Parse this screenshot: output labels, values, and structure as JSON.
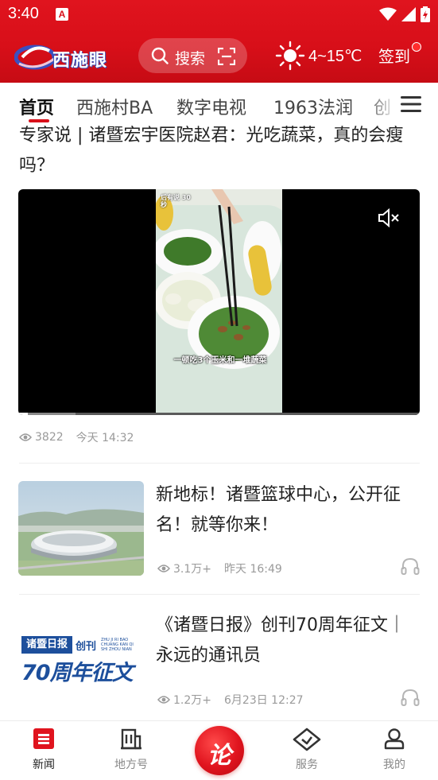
{
  "status_bar": {
    "time": "3:40",
    "notification_icon": "a-icon",
    "icons": [
      "wifi-icon",
      "signal-icon",
      "battery-icon"
    ]
  },
  "header": {
    "logo_text": "西施眼",
    "search_label": "搜索",
    "weather_icon": "sun-icon",
    "weather_temp": "4~15℃",
    "signin_label": "签到"
  },
  "tabs": [
    {
      "label": "首页",
      "active": true
    },
    {
      "label": "西施村BA",
      "active": false
    },
    {
      "label": "数字电视",
      "active": false
    },
    {
      "label": "1963法润",
      "active": false
    },
    {
      "label": "创",
      "active": false
    }
  ],
  "feed": {
    "featured": {
      "title": "专家说 | 诸暨宏宇医院赵君：光吃蔬菜，真的会瘦吗？",
      "video_caption": "一顿吃3个玉米和一堆蔬菜",
      "video_watermark": "后有说 30秒",
      "views": "3822",
      "time": "今天 14:32"
    },
    "items": [
      {
        "title": "新地标！诸暨篮球中心，公开征名！就等你来！",
        "views": "3.1万+",
        "time": "昨天 16:49"
      },
      {
        "title": "《诸暨日报》创刊70周年征文｜永远的通讯员",
        "views": "1.2万+",
        "time": "6月23日 12:27",
        "thumb_line1": "诸暨日报",
        "thumb_line1b": "创刊",
        "thumb_line2": "70周年征文",
        "thumb_small": "ZHU JI RI BAO CHUANG KAN QI SHI ZHOU NIAN ZHENG WEN"
      }
    ]
  },
  "bottom_nav": [
    {
      "label": "新闻",
      "icon": "news-icon",
      "active": true
    },
    {
      "label": "地方号",
      "icon": "building-icon",
      "active": false
    },
    {
      "label": "论",
      "icon": "center-logo",
      "active": false
    },
    {
      "label": "服务",
      "icon": "diamond-heart-icon",
      "active": false
    },
    {
      "label": "我的",
      "icon": "user-icon",
      "active": false
    }
  ],
  "colors": {
    "brand_red": "#d80f19",
    "text_primary": "#222222",
    "text_meta": "#9a9a9a"
  }
}
